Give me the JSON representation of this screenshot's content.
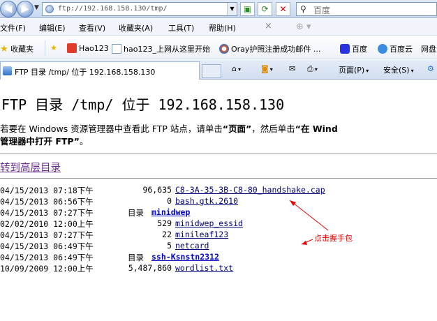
{
  "browser": {
    "address_url": "ftp://192.168.158.130/tmp/",
    "search_placeholder": "百度",
    "nav_back_glyph": "◀",
    "nav_fwd_glyph": "▶"
  },
  "menu": {
    "items": [
      {
        "label": "文件(F)"
      },
      {
        "label": "编辑(E)"
      },
      {
        "label": "查看(V)"
      },
      {
        "label": "收藏夹(A)"
      },
      {
        "label": "工具(T)"
      },
      {
        "label": "帮助(H)"
      }
    ],
    "close_glyph": "×"
  },
  "favorites": {
    "label": "收藏夹",
    "items": [
      {
        "label": "Hao123"
      },
      {
        "label": "hao123_上网从这里开始"
      },
      {
        "label": "Oray护照注册成功邮件 ..."
      },
      {
        "label": "百度"
      },
      {
        "label": "百度云"
      },
      {
        "label": "网盘"
      }
    ]
  },
  "tab": {
    "title": "FTP 目录 /tmp/ 位于 192.168.158.130"
  },
  "commands": {
    "page_label": "页面(P)",
    "safety_label": "安全(S)"
  },
  "page": {
    "title": "FTP 目录 /tmp/ 位于 192.168.158.130",
    "info_line1_pre": "若要在 Windows 资源管理器中查看此 FTP 站点，请单击",
    "info_page_word": "“页面”",
    "info_line1_mid": "，然后单击",
    "info_line1_bold": "“在 Wind",
    "info_line2_bold": "管理器中打开 FTP”",
    "info_line2_end": "。",
    "up_link": "转到高层目录",
    "dir_label": "目录",
    "entries": [
      {
        "date": "04/15/2013 07:18下午",
        "size": "96,635",
        "name": "C8-3A-35-3B-C8-80_handshake.cap",
        "is_dir": false
      },
      {
        "date": "04/15/2013 06:56下午",
        "size": "0",
        "name": "bash.gtk.2610",
        "is_dir": false
      },
      {
        "date": "04/15/2013 07:27下午",
        "size": "",
        "name": "minidwep",
        "is_dir": true
      },
      {
        "date": "02/02/2010 12:00上午",
        "size": "529",
        "name": "minidwep_essid",
        "is_dir": false
      },
      {
        "date": "04/15/2013 07:27下午",
        "size": "22",
        "name": "minileaf123",
        "is_dir": false
      },
      {
        "date": "04/15/2013 06:49下午",
        "size": "5",
        "name": "netcard",
        "is_dir": false
      },
      {
        "date": "04/15/2013 06:49下午",
        "size": "",
        "name": "ssh-Ksnstn2312",
        "is_dir": true
      },
      {
        "date": "10/09/2009 12:00上午",
        "size": "5,487,860",
        "name": "wordlist.txt",
        "is_dir": false
      }
    ]
  },
  "annotation": {
    "text": "点击握手包",
    "color": "#e00000"
  }
}
